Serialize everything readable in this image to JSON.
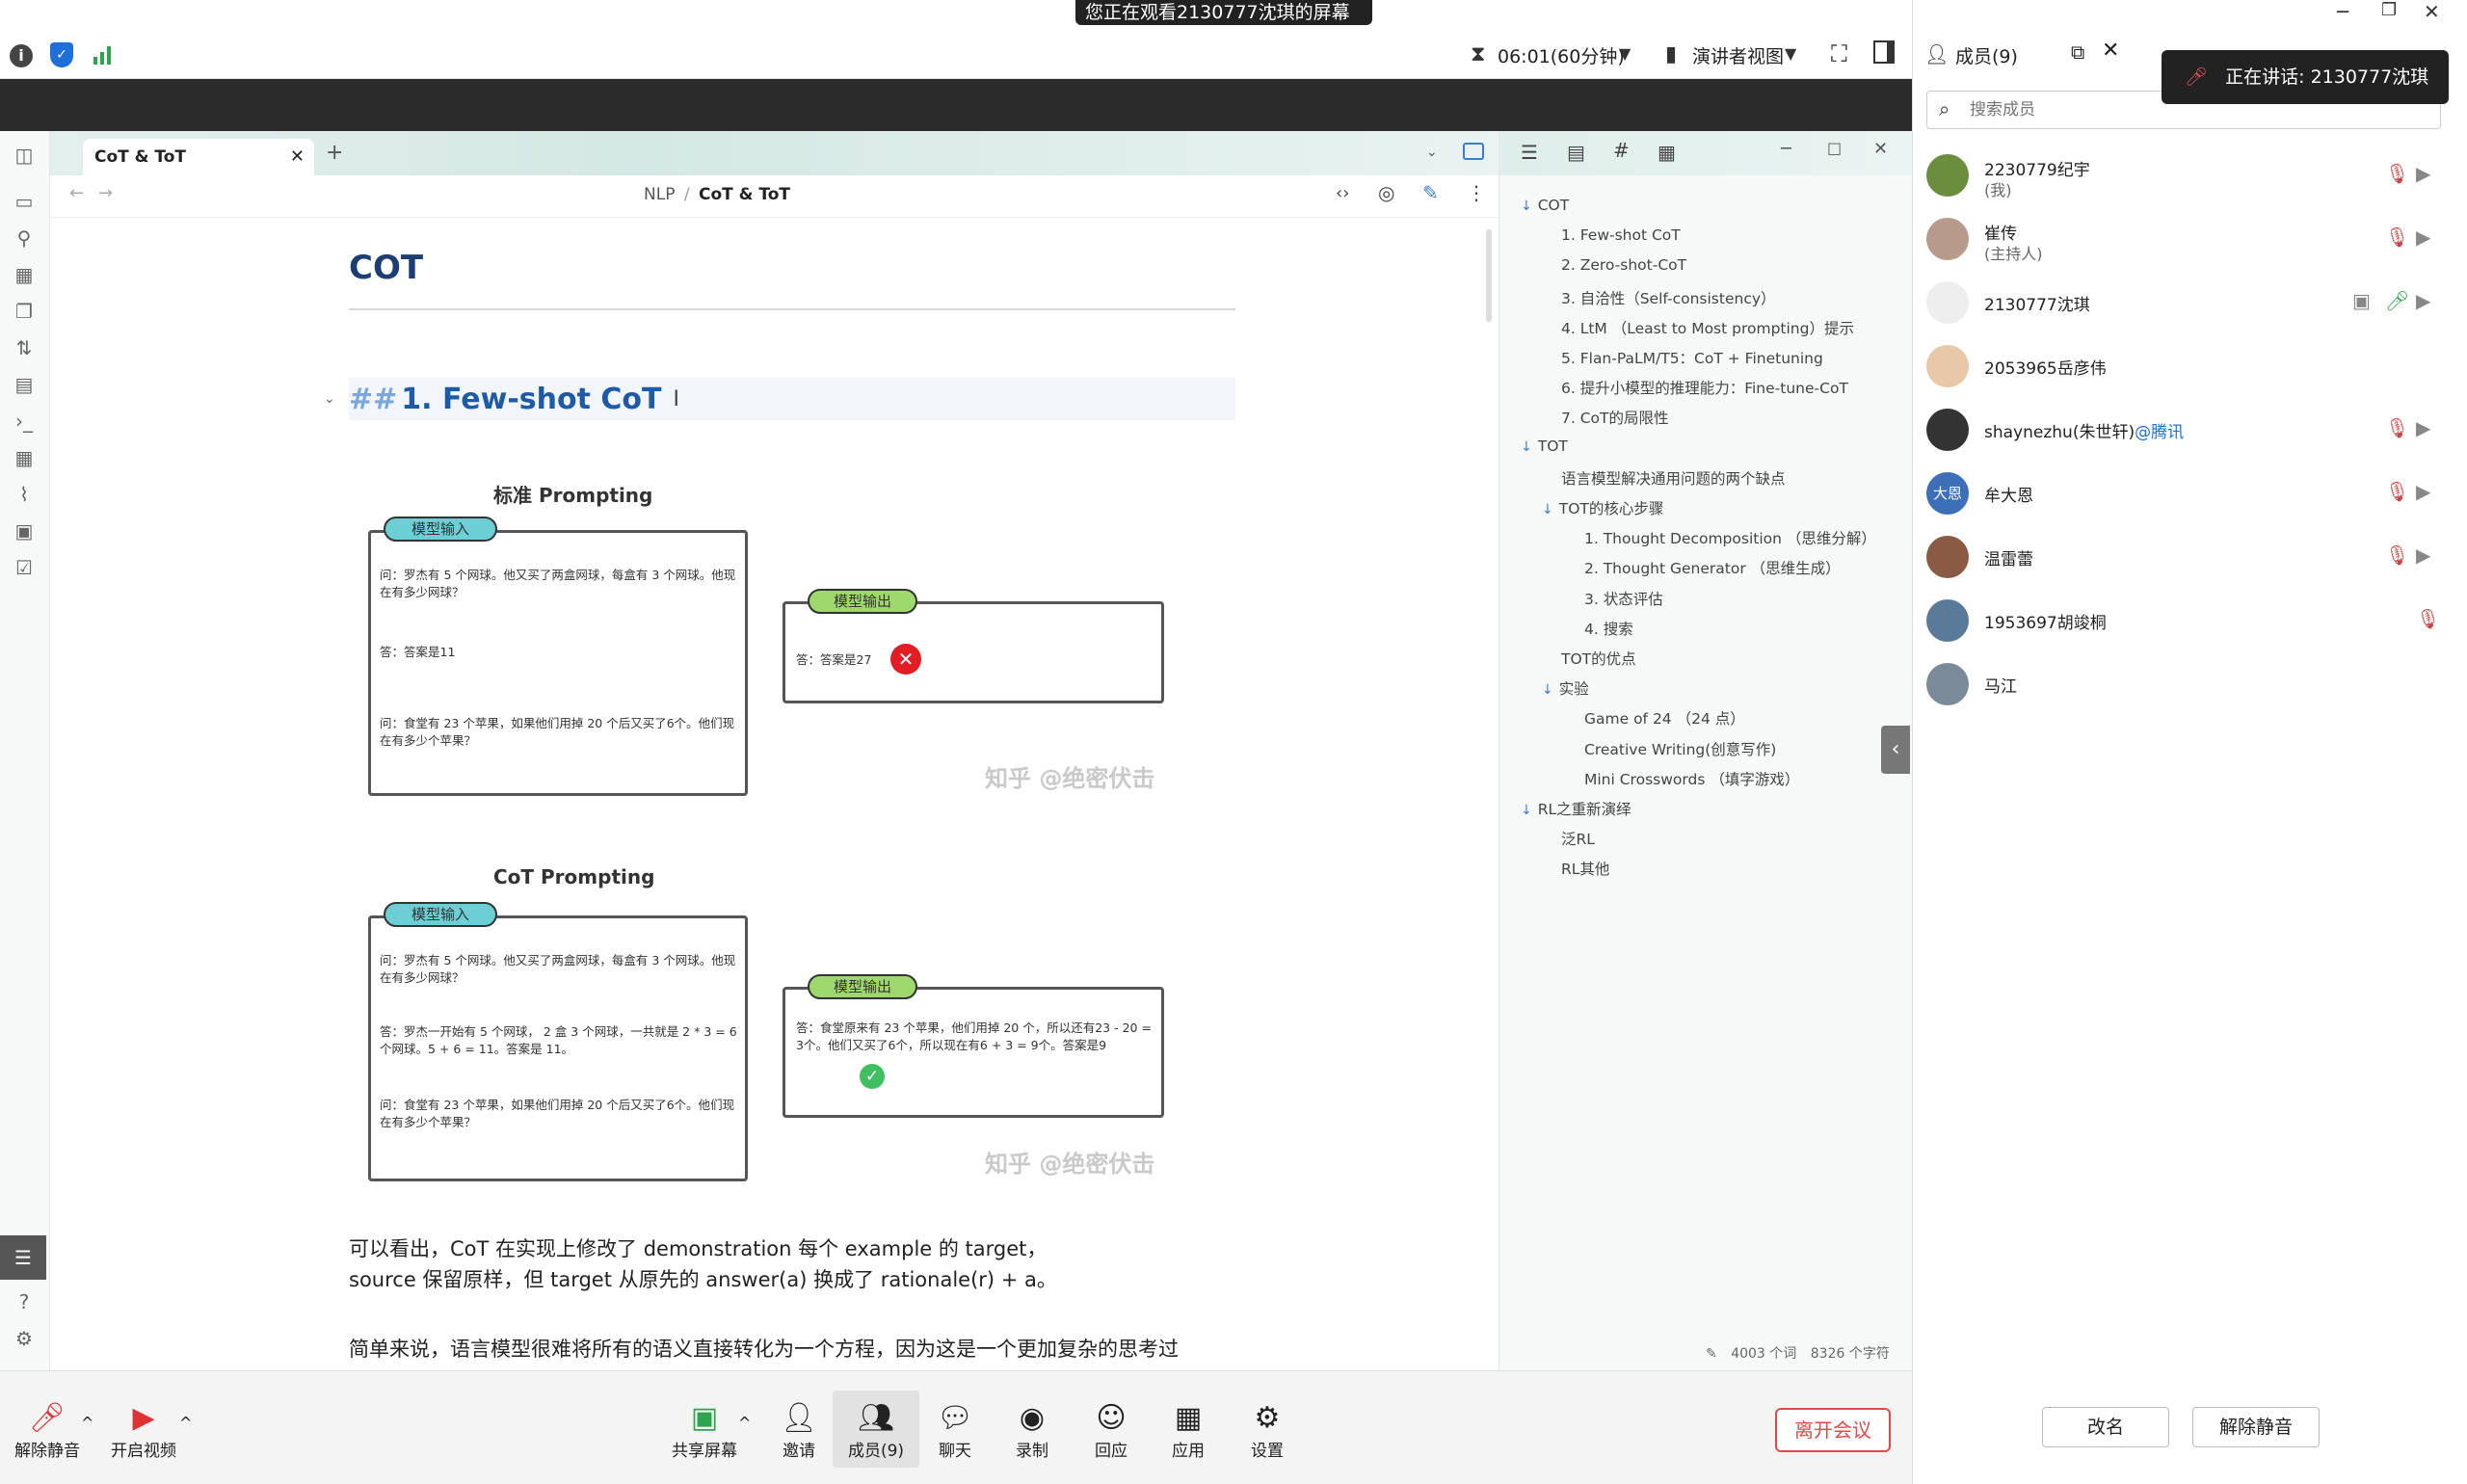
{
  "meeting": {
    "banner": "您正在观看2130777沈琪的屏幕",
    "timer": "06:01(60分钟)",
    "view_mode": "演讲者视图",
    "speaking": "正在讲话:  2130777沈琪"
  },
  "editor": {
    "tab_title": "CoT & ToT",
    "breadcrumb_parent": "NLP",
    "breadcrumb_sep": "/",
    "breadcrumb_current": "CoT & ToT",
    "h1": "COT",
    "h2_marker": "##",
    "h2": "1. Few-shot CoT",
    "fig1": {
      "title": "标准 Prompting",
      "input_pill": "模型输入",
      "output_pill": "模型输出",
      "q1": "问：罗杰有 5 个网球。他又买了两盒网球，每盒有 3 个网球。他现在有多少网球？",
      "a1": "答：答案是11",
      "q2": "问：食堂有 23 个苹果，如果他们用掉 20 个后又买了6个。他们现在有多少个苹果？",
      "out": "答：答案是27",
      "watermark": "知乎 @绝密伏击"
    },
    "fig2": {
      "title": "CoT Prompting",
      "input_pill": "模型输入",
      "output_pill": "模型输出",
      "q1": "问：罗杰有 5 个网球。他又买了两盒网球，每盒有 3 个网球。他现在有多少网球？",
      "a1": "答：罗杰一开始有 5 个网球， 2 盒 3 个网球，一共就是 2 * 3 = 6 个网球。5 + 6 = 11。答案是 11。",
      "q2": "问：食堂有 23 个苹果，如果他们用掉 20 个后又买了6个。他们现在有多少个苹果？",
      "out": "答：食堂原来有 23 个苹果，他们用掉 20 个，所以还有23 - 20 = 3个。他们又买了6个，所以现在有6 + 3 = 9个。答案是9",
      "watermark": "知乎 @绝密伏击"
    },
    "para1_line1": "可以看出，CoT 在实现上修改了 demonstration 每个 example 的 target，",
    "para1_line2": "source 保留原样，但 target 从原先的 answer(a) 换成了 rationale(r) + a。",
    "para2_partial": "简单来说，语言模型很难将所有的语义直接转化为一个方程，因为这是一个更加复杂的思考过",
    "status_words": "4003 个词",
    "status_chars": "8326 个字符"
  },
  "outline": [
    {
      "label": "COT",
      "level": 0,
      "arrow": true
    },
    {
      "label": "1. Few-shot CoT",
      "level": 1
    },
    {
      "label": "2. Zero-shot-CoT",
      "level": 1
    },
    {
      "label": "3. 自洽性（Self-consistency）",
      "level": 1
    },
    {
      "label": "4. LtM （Least to Most prompting）提示",
      "level": 1
    },
    {
      "label": "5. Flan-PaLM/T5：CoT + Finetuning",
      "level": 1
    },
    {
      "label": "6. 提升小模型的推理能力：Fine-tune-CoT",
      "level": 1
    },
    {
      "label": "7. CoT的局限性",
      "level": 1
    },
    {
      "label": "TOT",
      "level": 0,
      "arrow": true
    },
    {
      "label": "语言模型解决通用问题的两个缺点",
      "level": 1
    },
    {
      "label": "TOT的核心步骤",
      "level": 1,
      "arrow": true
    },
    {
      "label": "1. Thought Decomposition （思维分解）",
      "level": 2
    },
    {
      "label": "2. Thought Generator （思维生成）",
      "level": 2
    },
    {
      "label": "3. 状态评估",
      "level": 2
    },
    {
      "label": "4. 搜索",
      "level": 2
    },
    {
      "label": "TOT的优点",
      "level": 1
    },
    {
      "label": "实验",
      "level": 1,
      "arrow": true
    },
    {
      "label": "Game of 24 （24 点）",
      "level": 2
    },
    {
      "label": "Creative Writing(创意写作)",
      "level": 2
    },
    {
      "label": "Mini Crosswords （填字游戏）",
      "level": 2
    },
    {
      "label": "RL之重新演绎",
      "level": 0,
      "arrow": true
    },
    {
      "label": "泛RL",
      "level": 1
    },
    {
      "label": "RL其他",
      "level": 1
    }
  ],
  "toolbar": {
    "mute": "解除静音",
    "video": "开启视频",
    "share": "共享屏幕",
    "invite": "邀请",
    "members": "成员(9)",
    "chat": "聊天",
    "record": "录制",
    "react": "回应",
    "apps": "应用",
    "settings": "设置",
    "leave": "离开会议"
  },
  "panel": {
    "title": "成员(9)",
    "search_placeholder": "搜索成员",
    "members": [
      {
        "name": "2230779纪宇",
        "sub": "(我)",
        "avatar_color": "#6b8e3e"
      },
      {
        "name": "崔传",
        "sub": "(主持人)",
        "avatar_color": "#b89a8a"
      },
      {
        "name": "2130777沈琪",
        "sub": "",
        "avatar_color": "#eeeeee"
      },
      {
        "name": "2053965岳彦伟",
        "sub": "",
        "avatar_color": "#e8c8a8"
      },
      {
        "name": "shaynezhu(朱世轩)",
        "sub": "",
        "tag": "@腾讯",
        "avatar_color": "#333333"
      },
      {
        "name": "牟大恩",
        "sub": "",
        "avatar_color": "#3d6fb8",
        "initials": "大恩"
      },
      {
        "name": "温雷蕾",
        "sub": "",
        "avatar_color": "#8a5a44"
      },
      {
        "name": "1953697胡竣桐",
        "sub": "",
        "avatar_color": "#5a7a9a"
      },
      {
        "name": "马江",
        "sub": "",
        "avatar_color": "#7a8a98"
      }
    ],
    "rename": "改名",
    "unmute_all": "解除静音"
  }
}
